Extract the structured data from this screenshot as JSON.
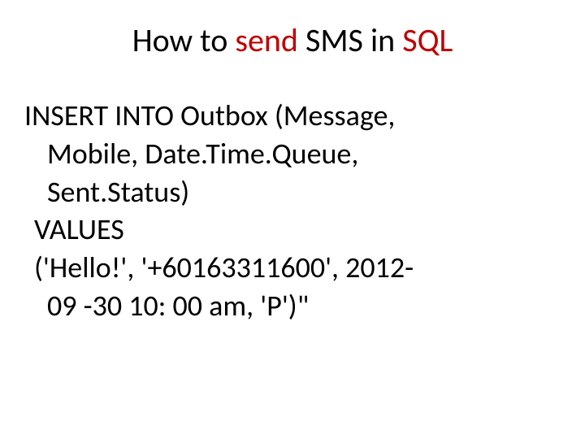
{
  "title": {
    "part1": "How to ",
    "highlight1": "send",
    "part2": " SMS in ",
    "highlight2": "SQL"
  },
  "code": {
    "line1": "INSERT INTO Outbox (Message,",
    "line2": "Mobile, Date.Time.Queue,",
    "line3": "Sent.Status)",
    "line4": "VALUES",
    "line5": "('Hello!', '+60163311600', 2012-",
    "line6": "09 -30 10: 00 am, 'P')\""
  }
}
